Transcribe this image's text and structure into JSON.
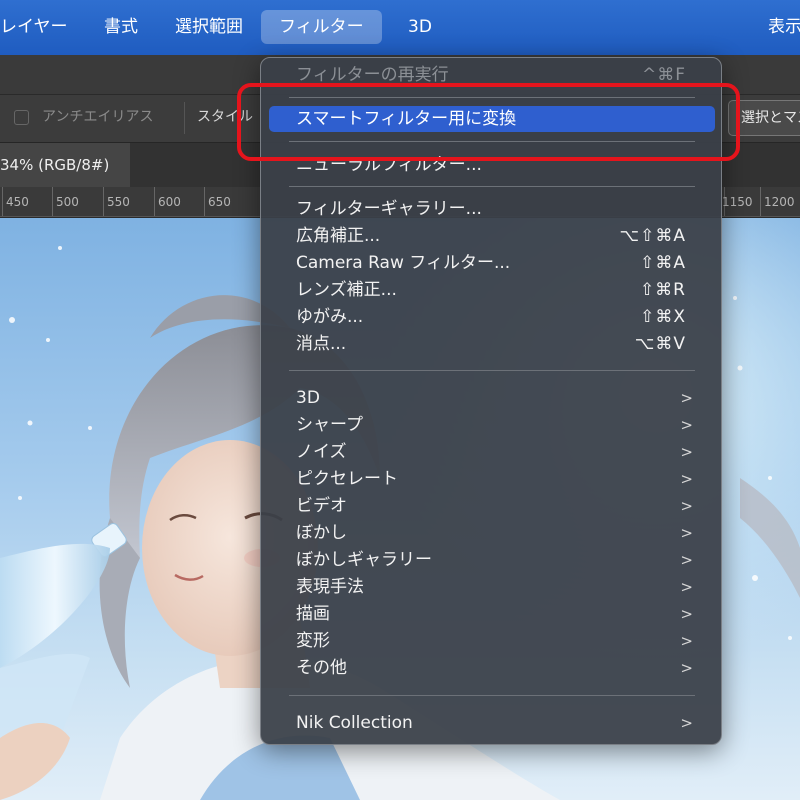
{
  "menubar": {
    "items": [
      "レイヤー",
      "書式",
      "選択範囲",
      "フィルター",
      "3D",
      "表示"
    ],
    "active_index": 3
  },
  "options_bar": {
    "antialias_label": "アンチエイリアス",
    "style_label": "スタイル",
    "select_mask_button": "選択とマスク..."
  },
  "document_tab": {
    "title": "34% (RGB/8#)"
  },
  "ruler": {
    "labels": [
      "450",
      "500",
      "550",
      "600",
      "650",
      "1150",
      "1200"
    ]
  },
  "filter_menu": {
    "items": [
      {
        "label": "フィルターの再実行",
        "shortcut": "^⌘F",
        "disabled": true
      },
      {
        "label": "スマートフィルター用に変換",
        "highlighted": true
      },
      {
        "label": "ニューラルフィルター..."
      },
      {
        "label": "フィルターギャラリー..."
      },
      {
        "label": "広角補正...",
        "shortcut": "⌥⇧⌘A"
      },
      {
        "label": "Camera Raw フィルター...",
        "shortcut": "⇧⌘A"
      },
      {
        "label": "レンズ補正...",
        "shortcut": "⇧⌘R"
      },
      {
        "label": "ゆがみ...",
        "shortcut": "⇧⌘X"
      },
      {
        "label": "消点...",
        "shortcut": "⌥⌘V"
      },
      {
        "label": "3D",
        "submenu": true
      },
      {
        "label": "シャープ",
        "submenu": true
      },
      {
        "label": "ノイズ",
        "submenu": true
      },
      {
        "label": "ピクセレート",
        "submenu": true
      },
      {
        "label": "ビデオ",
        "submenu": true
      },
      {
        "label": "ぼかし",
        "submenu": true
      },
      {
        "label": "ぼかしギャラリー",
        "submenu": true
      },
      {
        "label": "表現手法",
        "submenu": true
      },
      {
        "label": "描画",
        "submenu": true
      },
      {
        "label": "変形",
        "submenu": true
      },
      {
        "label": "その他",
        "submenu": true
      },
      {
        "label": "Nik Collection",
        "submenu": true
      }
    ],
    "submenu_arrow": ">"
  },
  "colors": {
    "menubar": "#2a66c9",
    "highlight": "#2f5fcf",
    "annotation": "#e5141c"
  },
  "icons": {
    "submenu": "chevron-right-icon"
  }
}
